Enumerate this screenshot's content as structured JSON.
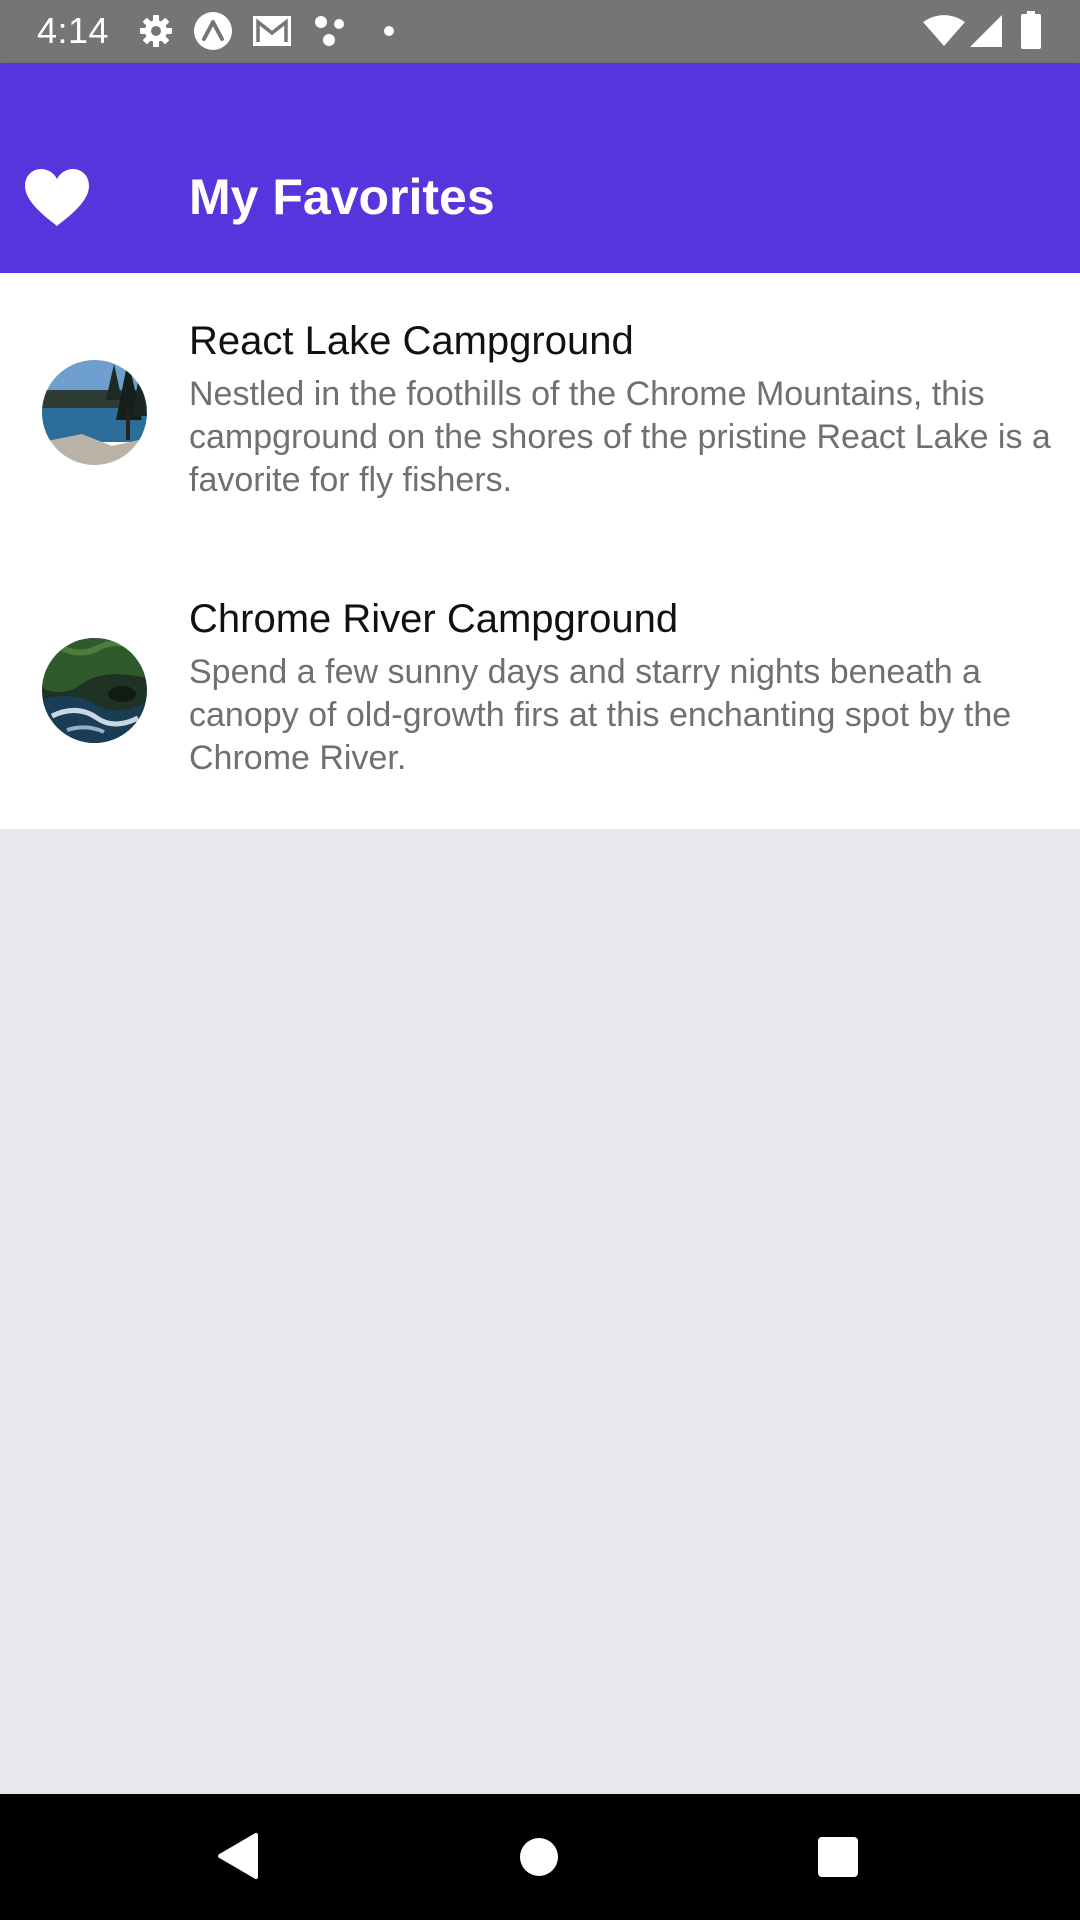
{
  "status_bar": {
    "time": "4:14",
    "icons": [
      "gear-icon",
      "expo-icon",
      "gmail-icon",
      "dots-icon",
      "dot-icon",
      "wifi-icon",
      "signal-icon",
      "battery-icon"
    ]
  },
  "app_bar": {
    "title": "My Favorites",
    "icon": "heart-icon",
    "background": "#5735dd"
  },
  "favorites": [
    {
      "title": "React Lake Campground",
      "description": "Nestled in the foothills of the Chrome Mountains, this campground on the shores of the pristine React Lake is a favorite for fly fishers."
    },
    {
      "title": "Chrome River Campground",
      "description": "Spend a few sunny days and starry nights beneath a canopy of old-growth firs at this enchanting spot by the Chrome River."
    }
  ],
  "nav_bar": {
    "buttons": [
      "back-icon",
      "home-icon",
      "recents-icon"
    ]
  }
}
